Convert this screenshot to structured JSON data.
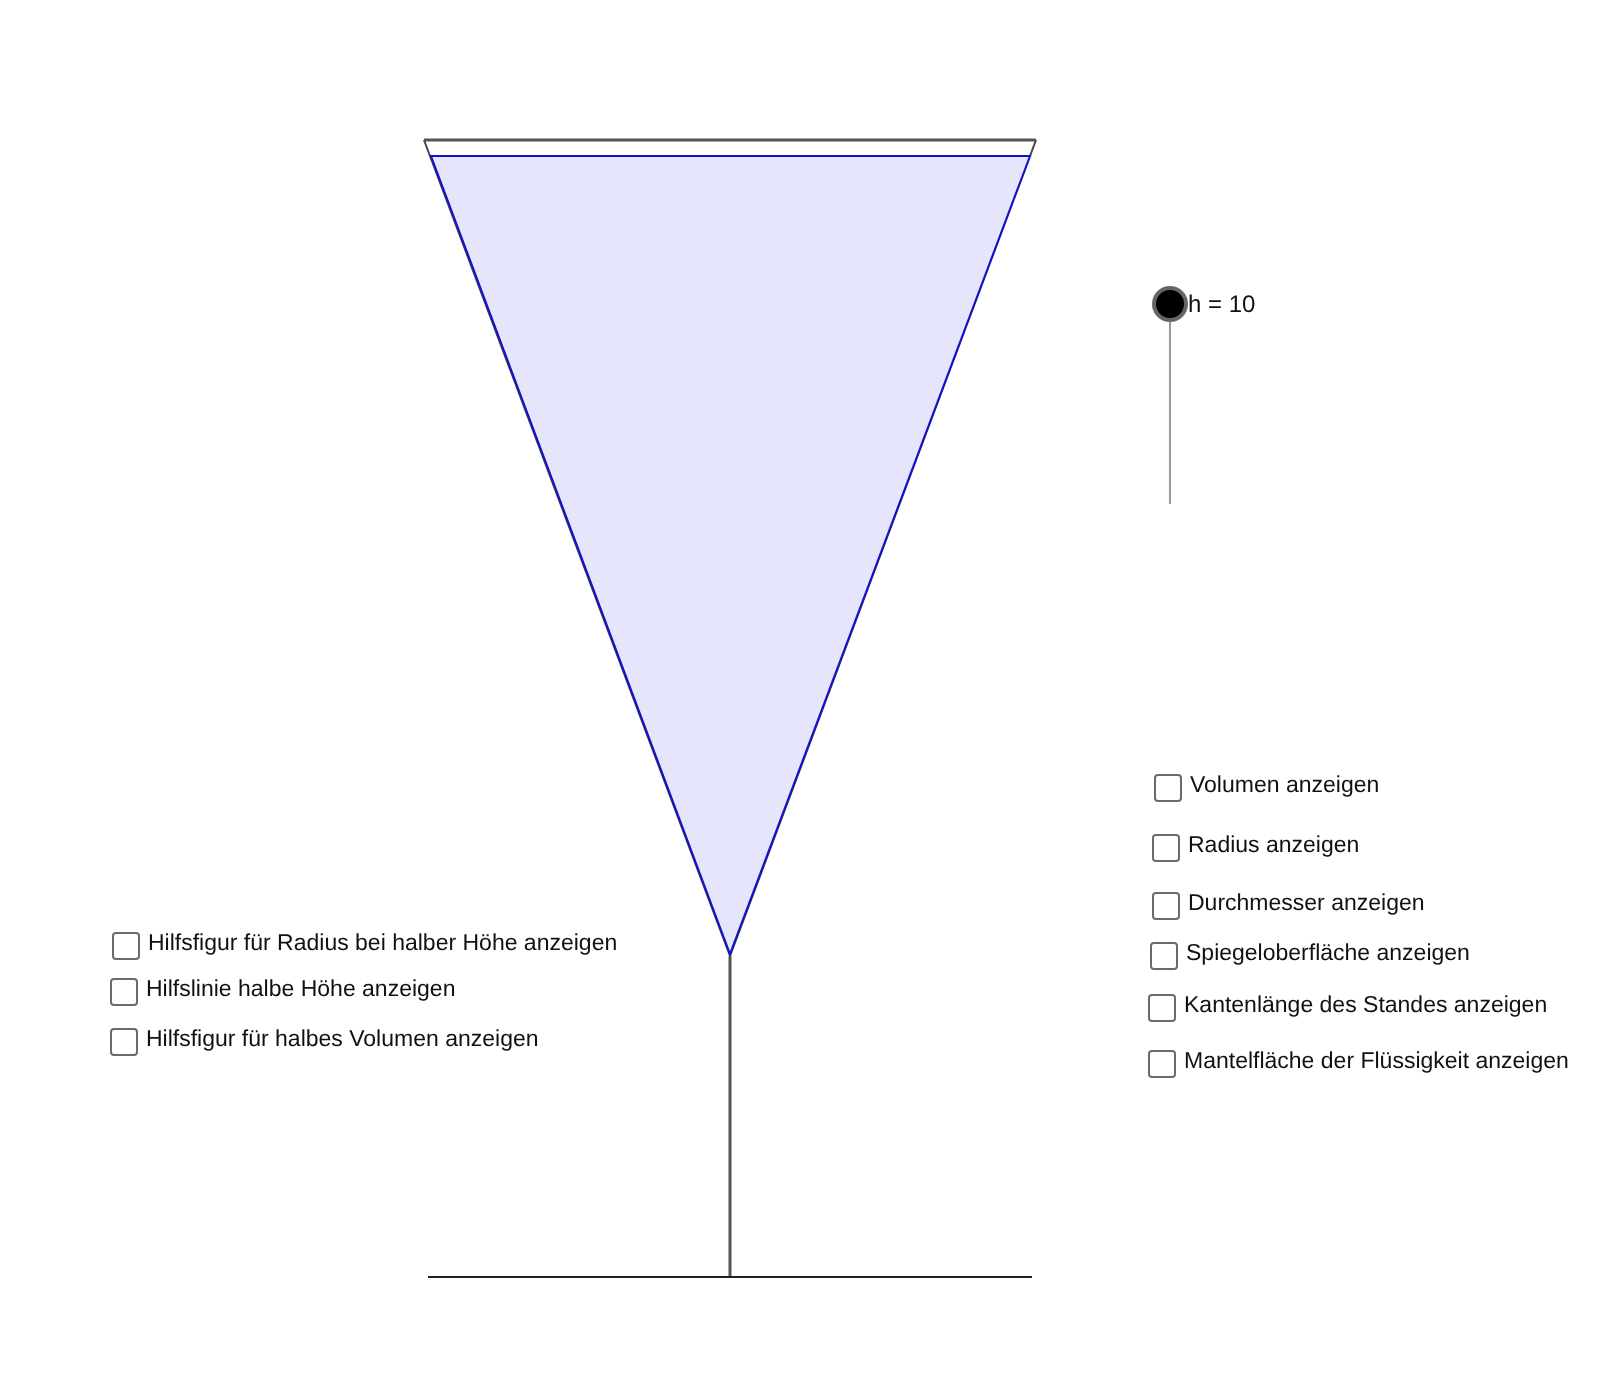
{
  "slider": {
    "label": "h = 10",
    "level": 1
  },
  "checkboxes_left": [
    {
      "label": "Hilfsfigur für Radius bei halber Höhe anzeigen",
      "checked": false
    },
    {
      "label": "Hilfslinie halbe Höhe anzeigen",
      "checked": false
    },
    {
      "label": "Hilfsfigur für halbes Volumen anzeigen",
      "checked": false
    }
  ],
  "checkboxes_right": [
    {
      "label": "Volumen anzeigen",
      "checked": false
    },
    {
      "label": "Radius anzeigen",
      "checked": false
    },
    {
      "label": "Durchmesser anzeigen",
      "checked": false
    },
    {
      "label": "Spiegeloberfläche anzeigen",
      "checked": false
    },
    {
      "label": "Kantenlänge des Standes anzeigen",
      "checked": false
    },
    {
      "label": "Mantelfläche der Flüssigkeit anzeigen",
      "checked": false
    }
  ]
}
